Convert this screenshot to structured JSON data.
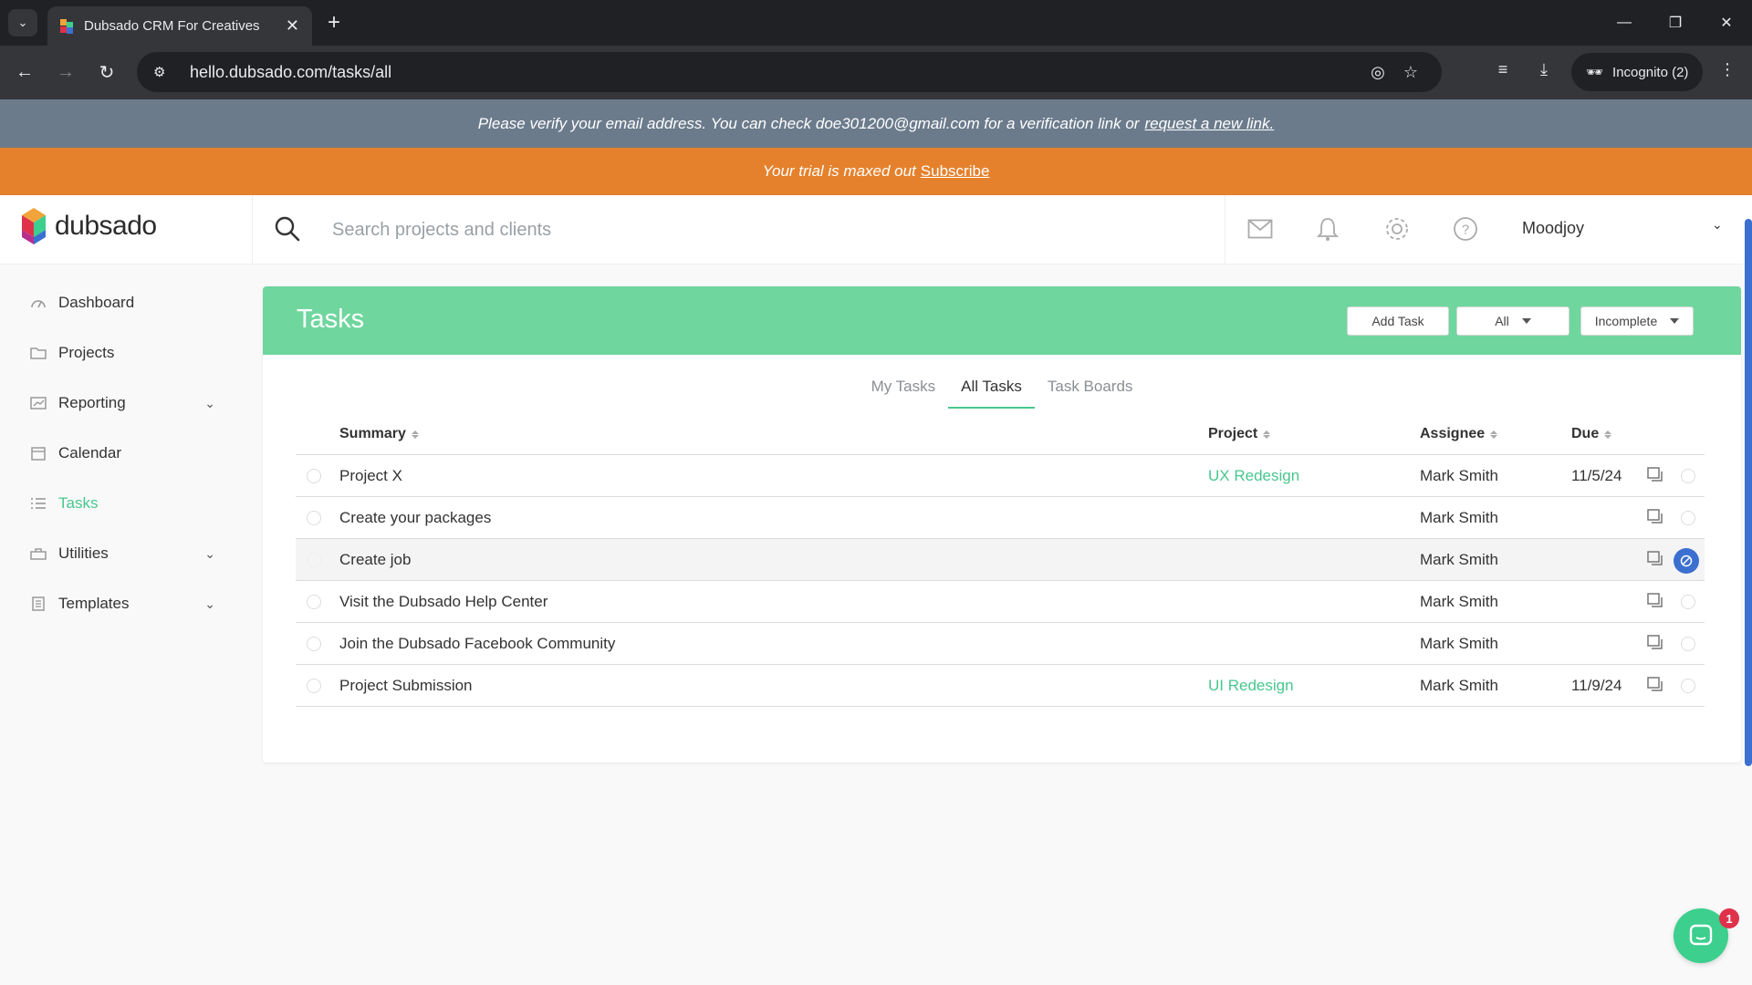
{
  "browser": {
    "tab_title": "Dubsado CRM For Creatives",
    "url": "hello.dubsado.com/tasks/all",
    "incognito_label": "Incognito (2)"
  },
  "banners": {
    "verify_text": "Please verify your email address. You can check doe301200@gmail.com for a verification link or",
    "verify_link": "request a new link.",
    "trial_text": "Your trial is maxed out",
    "trial_link": "Subscribe"
  },
  "header": {
    "logo_text": "dubsado",
    "search_placeholder": "Search projects and clients",
    "user_name": "Moodjoy"
  },
  "sidebar": {
    "items": [
      {
        "label": "Dashboard",
        "icon": "dashboard-icon"
      },
      {
        "label": "Projects",
        "icon": "projects-icon"
      },
      {
        "label": "Reporting",
        "icon": "reporting-icon",
        "expandable": true
      },
      {
        "label": "Calendar",
        "icon": "calendar-icon"
      },
      {
        "label": "Tasks",
        "icon": "tasks-icon",
        "active": true
      },
      {
        "label": "Utilities",
        "icon": "utilities-icon",
        "expandable": true
      },
      {
        "label": "Templates",
        "icon": "templates-icon",
        "expandable": true
      }
    ]
  },
  "tasks_page": {
    "title": "Tasks",
    "add_task_label": "Add Task",
    "filter_all_label": "All",
    "filter_status_label": "Incomplete",
    "tabs": [
      "My Tasks",
      "All Tasks",
      "Task Boards"
    ],
    "active_tab": "All Tasks",
    "columns": [
      "Summary",
      "Project",
      "Assignee",
      "Due"
    ],
    "rows": [
      {
        "summary": "Project X",
        "project": "UX Redesign",
        "assignee": "Mark Smith",
        "due": "11/5/24"
      },
      {
        "summary": "Create your packages",
        "project": "",
        "assignee": "Mark Smith",
        "due": ""
      },
      {
        "summary": "Create job",
        "project": "",
        "assignee": "Mark Smith",
        "due": ""
      },
      {
        "summary": "Visit the Dubsado Help Center",
        "project": "",
        "assignee": "Mark Smith",
        "due": ""
      },
      {
        "summary": "Join the Dubsado Facebook Community",
        "project": "",
        "assignee": "Mark Smith",
        "due": ""
      },
      {
        "summary": "Project Submission",
        "project": "UI Redesign",
        "assignee": "Mark Smith",
        "due": "11/9/24"
      }
    ]
  },
  "chat": {
    "badge_count": "1"
  },
  "colors": {
    "accent_green": "#6fd69e",
    "link_green": "#48c78e",
    "trial_orange": "#e5812c",
    "verify_gray": "#6b7b8c"
  }
}
